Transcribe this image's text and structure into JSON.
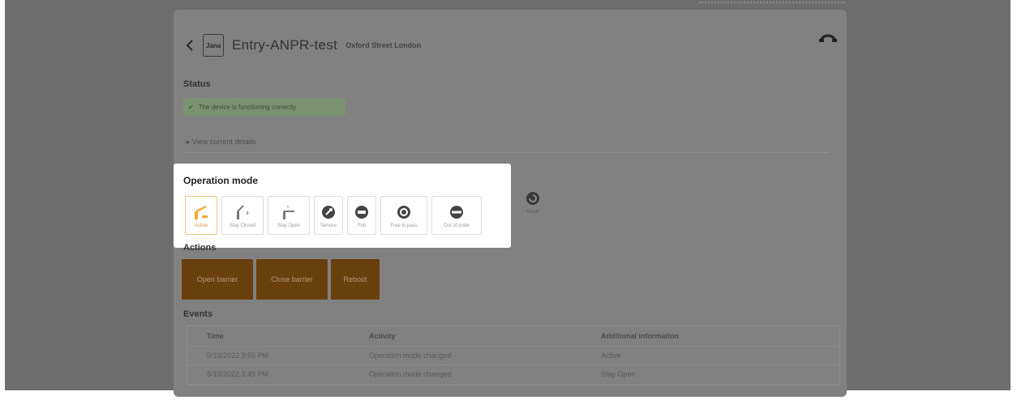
{
  "header": {
    "title": "Entry-ANPR-test",
    "subtitle": "Oxford Street London",
    "logo_text": "Jana"
  },
  "status": {
    "label": "Status",
    "message": "The device is functioning correctly",
    "details_link": "View current details"
  },
  "operation_mode": {
    "label": "Operation mode",
    "modes": [
      {
        "label": "Active",
        "icon": "barrier-active-icon",
        "active": true
      },
      {
        "label": "Stay Closed",
        "icon": "barrier-closed-icon",
        "active": false
      },
      {
        "label": "Stay Open",
        "icon": "barrier-open-icon",
        "active": false
      },
      {
        "label": "Service",
        "icon": "wrench-icon",
        "active": false
      },
      {
        "label": "Full",
        "icon": "full-icon",
        "active": false
      },
      {
        "label": "Free to pass",
        "icon": "free-pass-icon",
        "active": false
      },
      {
        "label": "Out of order",
        "icon": "no-entry-icon",
        "active": false
      }
    ],
    "extra_mode": {
      "label": "Reset",
      "icon": "reset-icon"
    }
  },
  "actions": {
    "label": "Actions",
    "buttons": [
      "Open barrier",
      "Close barrier",
      "Reboot"
    ]
  },
  "events": {
    "label": "Events",
    "columns": [
      "Time",
      "Activity",
      "Additional information"
    ],
    "rows": [
      [
        "5/10/2022 3:50 PM",
        "Operation mode changed",
        "Active"
      ],
      [
        "5/10/2022 3:49 PM",
        "Operation mode changed",
        "Stay Open"
      ]
    ]
  },
  "colors": {
    "accent": "#f3a93c",
    "action_button": "#6a3f0e",
    "status_ok": "#799371"
  }
}
